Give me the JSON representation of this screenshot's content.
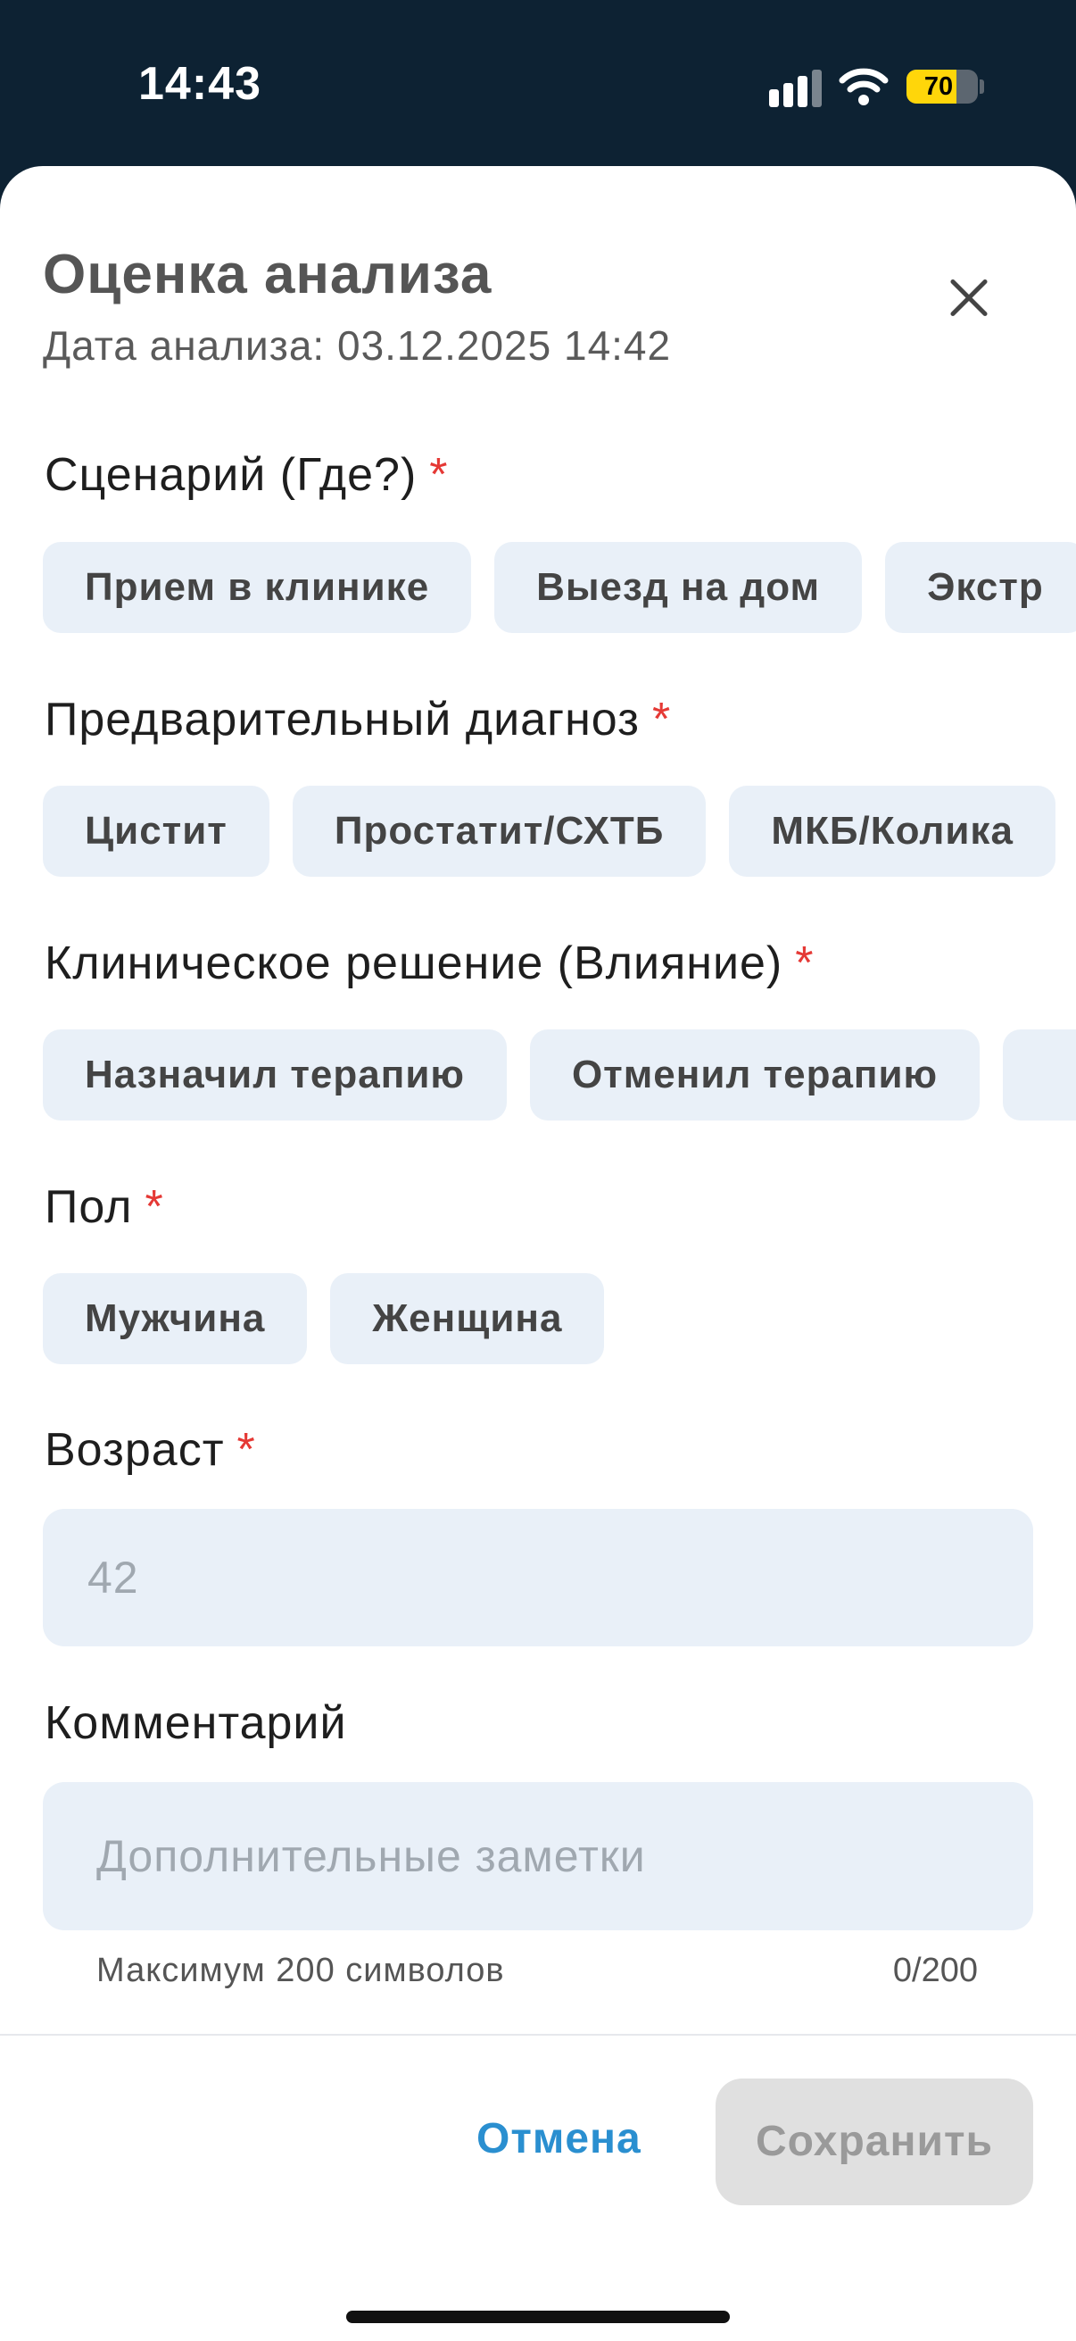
{
  "status_bar": {
    "time": "14:43",
    "battery_percent": 70
  },
  "sheet": {
    "title": "Оценка анализа",
    "subtitle": "Дата анализа: 03.12.2025 14:42",
    "required_mark": "*",
    "scenario": {
      "label": "Сценарий (Где?)",
      "options": [
        "Прием в клинике",
        "Выезд на дом",
        "Экстр"
      ]
    },
    "diagnosis": {
      "label": "Предварительный диагноз",
      "options": [
        "Цистит",
        "Простатит/СХТБ",
        "МКБ/Колика"
      ]
    },
    "decision": {
      "label": "Клиническое решение (Влияние)",
      "options": [
        "Назначил терапию",
        "Отменил терапию",
        ""
      ]
    },
    "sex": {
      "label": "Пол",
      "options": [
        "Мужчина",
        "Женщина"
      ]
    },
    "age": {
      "label": "Возраст",
      "placeholder": "42"
    },
    "comment": {
      "label": "Комментарий",
      "placeholder": "Дополнительные заметки",
      "hint": "Максимум 200 символов",
      "counter": "0/200"
    },
    "cancel_label": "Отмена",
    "save_label": "Сохранить"
  }
}
